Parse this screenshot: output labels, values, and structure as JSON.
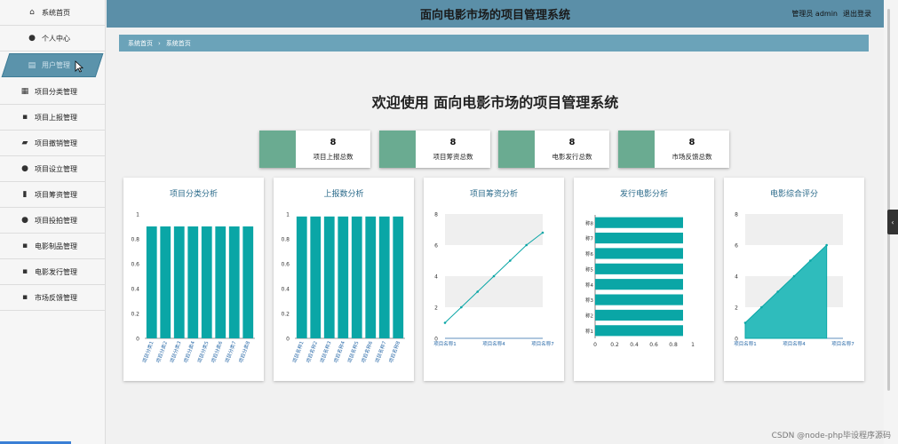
{
  "sidebar": {
    "items": [
      {
        "label": "系统首页",
        "icon": "home-icon",
        "glyph": "⌂"
      },
      {
        "label": "个人中心",
        "icon": "user-icon",
        "glyph": "●"
      },
      {
        "label": "用户管理",
        "icon": "users-icon",
        "glyph": "▤",
        "active": true
      },
      {
        "label": "项目分类管理",
        "icon": "chart-icon",
        "glyph": "▦"
      },
      {
        "label": "项目上报管理",
        "icon": "grid-icon",
        "glyph": "▪"
      },
      {
        "label": "项目撤销管理",
        "icon": "folder-icon",
        "glyph": "▰"
      },
      {
        "label": "项目设立管理",
        "icon": "user-icon",
        "glyph": "●"
      },
      {
        "label": "项目筹资管理",
        "icon": "clipboard-icon",
        "glyph": "▮"
      },
      {
        "label": "项目投拍管理",
        "icon": "user-icon",
        "glyph": "●"
      },
      {
        "label": "电影制品管理",
        "icon": "grid-icon",
        "glyph": "▪"
      },
      {
        "label": "电影发行管理",
        "icon": "grid-icon",
        "glyph": "▪"
      },
      {
        "label": "市场反馈管理",
        "icon": "grid-icon",
        "glyph": "▪"
      }
    ]
  },
  "header": {
    "title": "面向电影市场的项目管理系统",
    "user_label": "管理员 admin",
    "logout_label": "退出登录"
  },
  "breadcrumb": {
    "home": "系统首页",
    "sep": "›",
    "current": "系统首页"
  },
  "welcome": "欢迎使用 面向电影市场的项目管理系统",
  "stats": [
    {
      "value": "8",
      "label": "项目上报总数"
    },
    {
      "value": "8",
      "label": "项目筹资总数"
    },
    {
      "value": "8",
      "label": "电影发行总数"
    },
    {
      "value": "8",
      "label": "市场反馈总数"
    }
  ],
  "colors": {
    "accent": "#0aa6a6",
    "header": "#5b8fa8",
    "stat_swatch": "#6aab91"
  },
  "chart_data": [
    {
      "type": "bar",
      "title": "项目分类分析",
      "categories": [
        "项目分类1",
        "项目分类2",
        "项目分类3",
        "项目分类4",
        "项目分类5",
        "项目分类6",
        "项目分类7",
        "项目分类8"
      ],
      "values": [
        0.9,
        0.9,
        0.9,
        0.9,
        0.9,
        0.9,
        0.9,
        0.9
      ],
      "ylim": [
        0,
        1
      ],
      "yticks": [
        "0",
        "0.2",
        "0.4",
        "0.6",
        "0.8",
        "1"
      ]
    },
    {
      "type": "bar",
      "title": "上报数分析",
      "categories": [
        "项目名称1",
        "项目名称2",
        "项目名称3",
        "项目名称4",
        "项目名称5",
        "项目名称6",
        "项目名称7",
        "项目名称8"
      ],
      "values": [
        0.98,
        0.98,
        0.98,
        0.98,
        0.98,
        0.98,
        0.98,
        0.98
      ],
      "ylim": [
        0,
        1
      ],
      "yticks": [
        "0",
        "0.2",
        "0.4",
        "0.6",
        "0.8",
        "1"
      ]
    },
    {
      "type": "line",
      "title": "项目筹资分析",
      "x": [
        "项目名称1",
        "项目名称2",
        "项目名称3",
        "项目名称4",
        "项目名称5",
        "项目名称6",
        "项目名称7"
      ],
      "xticks": [
        "项目名称1",
        "项目名称4",
        "项目名称7"
      ],
      "values": [
        1,
        2,
        3,
        4,
        5,
        6,
        6.8
      ],
      "ylim": [
        0,
        8
      ],
      "yticks": [
        "0",
        "2",
        "4",
        "6",
        "8"
      ]
    },
    {
      "type": "bar",
      "orientation": "horizontal",
      "title": "发行电影分析",
      "categories": [
        "称1",
        "称2",
        "称3",
        "称4",
        "称5",
        "称6",
        "称7",
        "称8"
      ],
      "values": [
        0.9,
        0.9,
        0.9,
        0.9,
        0.9,
        0.9,
        0.9,
        0.9
      ],
      "xlim": [
        0,
        1
      ],
      "xticks": [
        "0",
        "0.2",
        "0.4",
        "0.6",
        "0.8",
        "1"
      ]
    },
    {
      "type": "area",
      "title": "电影综合评分",
      "x": [
        "项目名称1",
        "项目名称2",
        "项目名称3",
        "项目名称4",
        "项目名称5",
        "项目名称6",
        "项目名称7"
      ],
      "xticks": [
        "项目名称1",
        "项目名称4",
        "项目名称7"
      ],
      "values": [
        1,
        2,
        3,
        4,
        5,
        6
      ],
      "ylim": [
        0,
        8
      ],
      "yticks": [
        "0",
        "2",
        "4",
        "6",
        "8"
      ]
    }
  ],
  "watermark": "CSDN @node-php毕设程序源码"
}
